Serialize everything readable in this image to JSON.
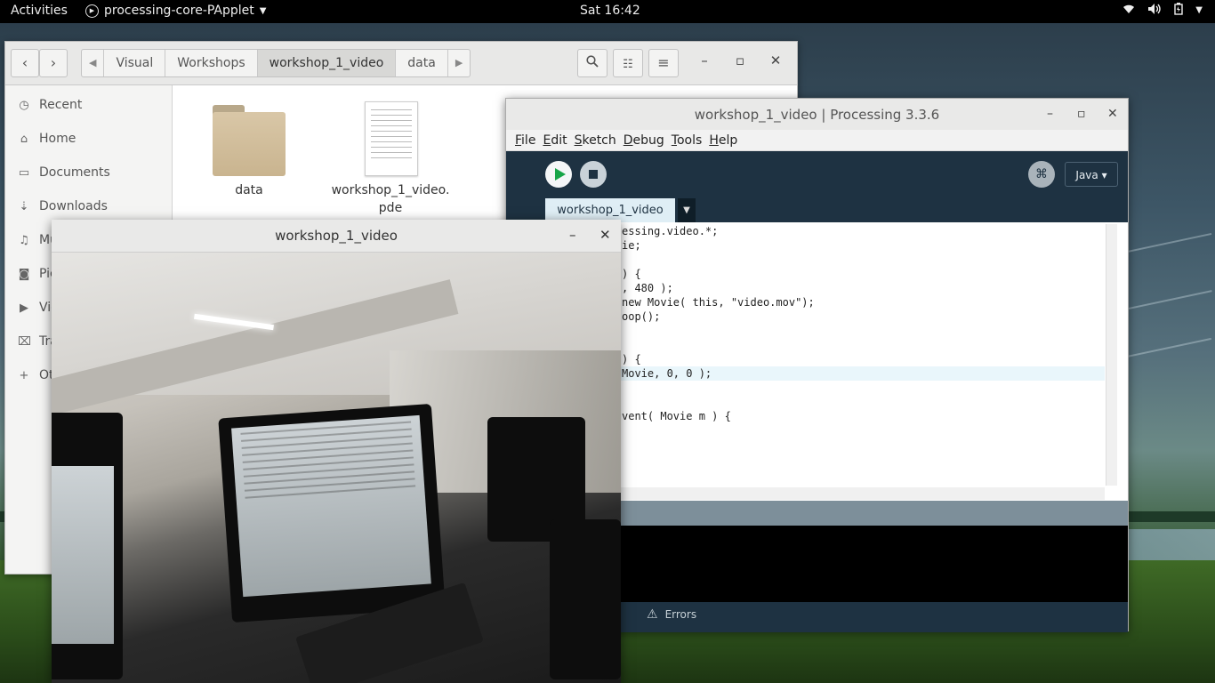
{
  "topbar": {
    "activities": "Activities",
    "app_name": "processing-core-PApplet",
    "clock": "Sat 16:42"
  },
  "files": {
    "breadcrumbs": [
      "Visual",
      "Workshops",
      "workshop_1_video",
      "data"
    ],
    "sidebar": [
      {
        "label": "Recent",
        "icon": "clock-icon"
      },
      {
        "label": "Home",
        "icon": "home-icon"
      },
      {
        "label": "Documents",
        "icon": "documents-icon"
      },
      {
        "label": "Downloads",
        "icon": "download-icon"
      },
      {
        "label": "Mu",
        "icon": "music-icon"
      },
      {
        "label": "Pic",
        "icon": "camera-icon"
      },
      {
        "label": "Vid",
        "icon": "video-icon"
      },
      {
        "label": "Tra",
        "icon": "trash-icon"
      },
      {
        "label": "Ot",
        "icon": "plus-icon"
      }
    ],
    "items": [
      {
        "name": "data",
        "type": "folder"
      },
      {
        "name": "workshop_1_video.",
        "name2": "pde",
        "type": "file"
      }
    ]
  },
  "ide": {
    "title": "workshop_1_video | Processing 3.3.6",
    "menu": [
      "File",
      "Edit",
      "Sketch",
      "Debug",
      "Tools",
      "Help"
    ],
    "mode": "Java ▾",
    "tab": "workshop_1_video",
    "code": [
      "essing.video.*;",
      "ie;",
      "",
      ") {",
      ", 480 );",
      "new Movie( this, \"video.mov\");",
      "oop();",
      "",
      "",
      ") {",
      "Movie, 0, 0 );",
      "",
      "",
      "vent( Movie m ) {"
    ],
    "errors_label": "Errors"
  },
  "sketch": {
    "title": "workshop_1_video"
  }
}
